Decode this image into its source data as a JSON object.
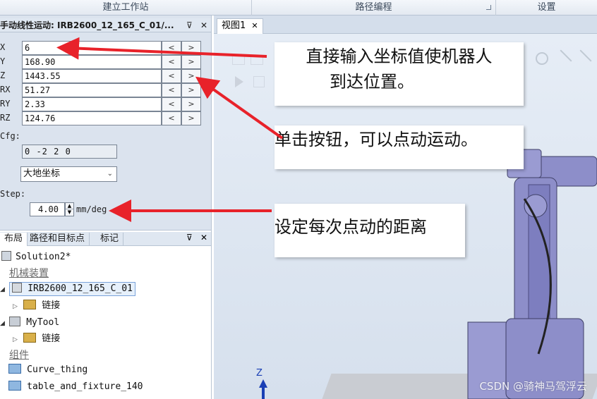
{
  "ribbon": {
    "groups": [
      "建立工作站",
      "路径编程",
      "设置"
    ]
  },
  "jog_panel": {
    "title": "手动线性运动: IRB2600_12_165_C_01/...",
    "fields": [
      {
        "label": "X",
        "value": "6"
      },
      {
        "label": "Y",
        "value": "168.90"
      },
      {
        "label": "Z",
        "value": "1443.55"
      },
      {
        "label": "RX",
        "value": "51.27"
      },
      {
        "label": "RY",
        "value": "2.33"
      },
      {
        "label": "RZ",
        "value": "124.76"
      }
    ],
    "jog_left": "<",
    "jog_right": ">",
    "cfg_label": "Cfg:",
    "cfg_value": "0 -2 2 0",
    "frame_select": "大地坐标",
    "step_label": "Step:",
    "step_value": "4.00",
    "step_unit": "mm/deg"
  },
  "layout_panel": {
    "tabs": [
      "布局",
      "路径和目标点",
      "标记"
    ],
    "tree": {
      "solution": "Solution2*",
      "mech_group": "机械装置",
      "robot": "IRB2600_12_165_C_01",
      "robot_child": "链接",
      "tool": "MyTool",
      "tool_child": "链接",
      "parts_group": "组件",
      "part1": "Curve_thing",
      "part2": "table_and_fixture_140"
    }
  },
  "viewport": {
    "tab_label": "视图1",
    "axis_label": "Z"
  },
  "annotations": {
    "note1_line1": "直接输入坐标值使机器人",
    "note1_line2": "到达位置。",
    "note2": "单击按钮，可以点动运动。",
    "note3": "设定每次点动的距离"
  },
  "watermark": "CSDN @骑神马驾浮云",
  "colors": {
    "arrow": "#e8222a",
    "robot": "#8d8ec9",
    "panel": "#dbe3ee"
  }
}
